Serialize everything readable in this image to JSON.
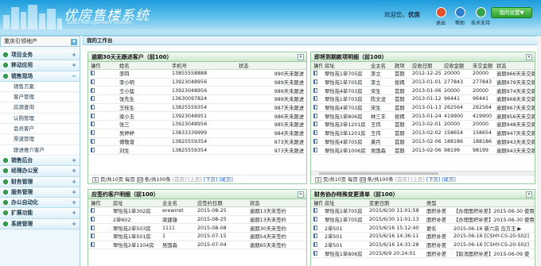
{
  "header": {
    "title": "优房售楼系统",
    "subtitle": "Sales Management System",
    "welcome_prefix": "欢迎您，",
    "user": "优房",
    "buttons": [
      {
        "label": "退出",
        "icon": "exit-icon",
        "color": "#e4512e"
      },
      {
        "label": "帮助",
        "icon": "help-icon",
        "color": "#2b7fd1"
      },
      {
        "label": "技术支持",
        "icon": "support-icon",
        "color": "#38a34f"
      }
    ],
    "settings_label": "我的设置▼"
  },
  "sidebar": {
    "dept": "重庆引领地产",
    "menu": [
      {
        "label": "项目业务",
        "expanded": false
      },
      {
        "label": "移动应用",
        "expanded": false
      },
      {
        "label": "销售现场",
        "expanded": true,
        "children": [
          "销售方案",
          "客户管理",
          "房源查询",
          "认购管理",
          "会员客户",
          "渠道管理",
          "跟进推介客户"
        ]
      },
      {
        "label": "销售后台",
        "expanded": false
      },
      {
        "label": "经理办公室",
        "expanded": false
      },
      {
        "label": "财务管理",
        "expanded": false
      },
      {
        "label": "服务管理",
        "expanded": false
      },
      {
        "label": "办公自动化",
        "expanded": false
      },
      {
        "label": "扩展功能",
        "expanded": false
      },
      {
        "label": "系统管理",
        "expanded": false
      }
    ]
  },
  "workbench_title": "我的工作台",
  "panels": {
    "overdue": {
      "title": "逾期30天无跟进客户（前100）",
      "columns": [
        "操作",
        "姓名",
        "手机号",
        "状态"
      ],
      "rows": [
        [
          "李四",
          "13855558888",
          "990天未跟进"
        ],
        [
          "李小明",
          "13923048956",
          "989天未跟进"
        ],
        [
          "王小猛",
          "13923048956",
          "989天未跟进"
        ],
        [
          "张先生",
          "13630097824",
          "989天未跟进"
        ],
        [
          "王桂生",
          "13825559354",
          "987天未跟进"
        ],
        [
          "梁小玉",
          "13923048951",
          "986天未跟进"
        ],
        [
          "张三",
          "13923048956",
          "985天未跟进"
        ],
        [
          "吴婷婷",
          "13833339999",
          "984天未跟进"
        ],
        [
          "傅敬谱",
          "13825559354",
          "973天未跟进"
        ],
        [
          "刘生",
          "13825559354",
          "973天未跟进"
        ]
      ],
      "pager": {
        "page": "1",
        "total_pages_text": "页/共10页 每页",
        "per_page": "10",
        "total_text": "条/共100条",
        "first": "[首页]",
        "prev": "[上页]",
        "next": "[下页]",
        "last": "[尾页]"
      }
    },
    "due": {
      "title": "即将到期款项明细（前100）",
      "columns": [
        "操作",
        "房址",
        "业主名",
        "款项",
        "应收日期",
        "应收金额",
        "未交金额",
        "状态"
      ],
      "rows": [
        [
          "翠怡苑1单705房",
          "李立",
          "首期",
          "2012-12-25",
          "20000",
          "20000",
          "逾期966天未交款"
        ],
        [
          "翠怡苑1单705房",
          "李立",
          "按揭",
          "2013-01-01",
          "277843",
          "277843",
          "逾期979天未交款"
        ],
        [
          "翠怡苑4单703房",
          "宋生",
          "首期",
          "2013-01-06",
          "20000",
          "20000",
          "逾期974天未交款"
        ],
        [
          "翠怡苑1单703房",
          "陈文龙",
          "首期",
          "2013-01-12",
          "96441",
          "96441",
          "逾期968天未交款"
        ],
        [
          "翠怡苑4单703房",
          "宋生",
          "首期",
          "2013-01-13",
          "262564",
          "262564",
          "逾期967天未交款"
        ],
        [
          "翠怡苑1单806房",
          "林三丰",
          "按揭",
          "2013-01-24",
          "419900",
          "419900",
          "逾期956天未交款"
        ],
        [
          "翠怡苑3单1201房",
          "王伟",
          "首期",
          "2013-02-01",
          "20000",
          "20000",
          "逾期948天未交款"
        ],
        [
          "翠怡苑3单1201房",
          "王伟",
          "首期",
          "2013-02-02",
          "158654",
          "158654",
          "逾期947天未交款"
        ],
        [
          "翠怡苑4单705房",
          "黄月",
          "首期",
          "2013-02-06",
          "188186",
          "188186",
          "逾期943天未交款"
        ],
        [
          "翠怡苑2单1006房",
          "吴国森",
          "首期",
          "2013-02-06",
          "98199",
          "98199",
          "逾期943天未交款"
        ]
      ],
      "pager": {
        "page": "1",
        "total_pages_text": "页/共10页 每页",
        "per_page": "10",
        "total_text": "条/共100条",
        "first": "[首页]",
        "prev": "[上页]",
        "next": "[下页]",
        "last": "[尾页]"
      }
    },
    "sign": {
      "title": "应签约客户明细（前100）",
      "columns": [
        "操作",
        "房址",
        "业主名",
        "应签约日期",
        "状态"
      ],
      "rows": [
        [
          "翠怡苑1单302房",
          "erewrret",
          "2015-08-25",
          "逾期13天未签约"
        ],
        [
          "2单602",
          "梁建雄",
          "2015-08-25",
          "逾期13天未签约"
        ],
        [
          "翠怡苑2单503房",
          "1111",
          "2015-08-08",
          "逾期30天未签约"
        ],
        [
          "翠怡苑1单501房",
          "1",
          "2015-07-15",
          "逾期54天未签约"
        ],
        [
          "翠怡苑2单1104房",
          "吴国森",
          "2015-07-04",
          "逾期65天未签约"
        ]
      ]
    },
    "changes": {
      "title": "财务协办特殊变更清单（前100）",
      "columns": [
        "操作",
        "房址",
        "变更日期",
        "类型",
        ""
      ],
      "rows": [
        [
          "翠怡苑1单705房",
          "2015/6/30 11:01:58",
          "面积补差",
          "【办理面积补差】2015-06-30 使用"
        ],
        [
          "翠怡苑1单705房",
          "2015/6/30 11:01:13",
          "面积补差",
          "【办理面积补差】2015-06-30 使用"
        ],
        [
          "2单501",
          "2015/6/16 15:12:40",
          "更名",
          "2015-06-16 新六店 岛方王 ▶"
        ],
        [
          "2单501",
          "2015/6/16 14:36:11",
          "面积补差",
          "2015-06-16 [CSHY-CS-20-S02]"
        ],
        [
          "2单501",
          "2015/6/16 14:31:28",
          "面积补差",
          "2015-06-16 [CSHY-CS-20-S02]"
        ],
        [
          "翠怡苑1单806房",
          "2015/6/9 20:24:01",
          "面积补差",
          "【取消面积补差】2015-06-09 使"
        ]
      ]
    }
  }
}
